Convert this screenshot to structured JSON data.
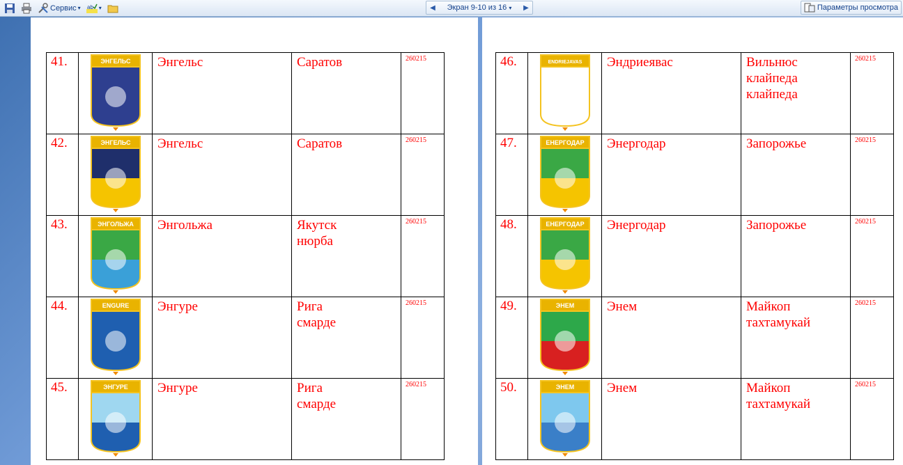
{
  "toolbar": {
    "service_label": "Сервис",
    "nav_label": "Экран 9-10 из 16",
    "params_label": "Параметры просмотра"
  },
  "pages": [
    {
      "rows": [
        {
          "num": "41.",
          "emblem_label": "ЭНГЕЛЬС",
          "name": "Энгельс",
          "place": [
            "Саратов"
          ],
          "code": "260215",
          "emblem_icon": "camel-emblem-icon",
          "colors": {
            "top": "#2e3f8f",
            "bottom": "#2e3f8f"
          }
        },
        {
          "num": "42.",
          "emblem_label": "ЭНГЕЛЬС",
          "name": "Энгельс",
          "place": [
            "Саратов"
          ],
          "code": "260215",
          "emblem_icon": "turbine-camel-emblem-icon",
          "colors": {
            "top": "#1f2f6b",
            "bottom": "#f5c400"
          }
        },
        {
          "num": "43.",
          "emblem_label": "ЭНГОЛЬЖА",
          "name": "Энгольжа",
          "place": [
            "Якутск",
            "нюрба"
          ],
          "code": "260215",
          "emblem_icon": "beehive-emblem-icon",
          "colors": {
            "top": "#3aa845",
            "bottom": "#3aa0d8"
          }
        },
        {
          "num": "44.",
          "emblem_label": "ENGURE",
          "name": "Энгуре",
          "place": [
            "Рига",
            "смарде"
          ],
          "code": "260215",
          "emblem_icon": "tree-emblem-icon",
          "colors": {
            "top": "#1f5fb0",
            "bottom": "#1f5fb0"
          }
        },
        {
          "num": "45.",
          "emblem_label": "ЭНГУРЕ",
          "name": "Энгуре",
          "place": [
            "Рига",
            "смарде"
          ],
          "code": "260215",
          "emblem_icon": "ship-swan-emblem-icon",
          "colors": {
            "top": "#9fd7f0",
            "bottom": "#1f5fb0"
          }
        }
      ]
    },
    {
      "rows": [
        {
          "num": "46.",
          "emblem_label": "ENDRIEJAVAS",
          "name": "Эндриеявас",
          "place": [
            "Вильнюс",
            "клайпеда",
            "клайпеда"
          ],
          "code": "260215",
          "emblem_icon": "church-emblem-icon",
          "colors": {
            "top": "#ffffff",
            "bottom": "#ffffff"
          }
        },
        {
          "num": "47.",
          "emblem_label": "ЕНЕРГОДАР",
          "name": "Энергодар",
          "place": [
            "Запорожье"
          ],
          "code": "260215",
          "emblem_icon": "sun-emblem-icon",
          "colors": {
            "top": "#3aa845",
            "bottom": "#f5c400"
          }
        },
        {
          "num": "48.",
          "emblem_label": "ЕНЕРГОДАР",
          "name": "Энергодар",
          "place": [
            "Запорожье"
          ],
          "code": "260215",
          "emblem_icon": "sun-emblem-icon",
          "colors": {
            "top": "#3aa845",
            "bottom": "#f5c400"
          }
        },
        {
          "num": "49.",
          "emblem_label": "ЭНЕМ",
          "name": "Энем",
          "place": [
            "Майкоп",
            "тахтамукай"
          ],
          "code": "260215",
          "emblem_icon": "arrows-emblem-icon",
          "colors": {
            "top": "#2da84a",
            "bottom": "#d82020"
          }
        },
        {
          "num": "50.",
          "emblem_label": "ЭНЕМ",
          "name": "Энем",
          "place": [
            "Майкоп",
            "тахтамукай"
          ],
          "code": "260215",
          "emblem_icon": "landscape-emblem-icon",
          "colors": {
            "top": "#7ec8ee",
            "bottom": "#3a7fc8"
          }
        }
      ]
    }
  ]
}
